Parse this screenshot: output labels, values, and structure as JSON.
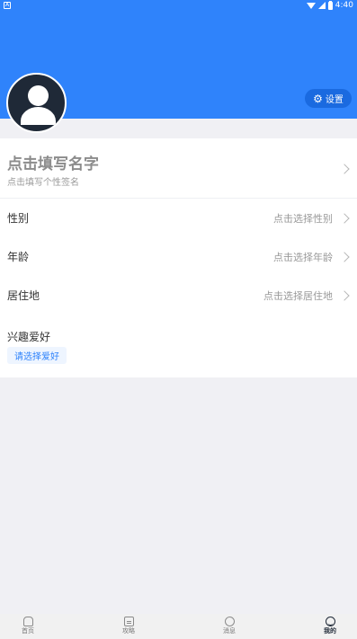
{
  "status_bar": {
    "time": "4:40",
    "left_icon": "A"
  },
  "settings_button": {
    "label": "设置",
    "icon": "gear-icon"
  },
  "profile": {
    "name_placeholder": "点击填写名字",
    "signature_placeholder": "点击填写个性签名"
  },
  "fields": [
    {
      "label": "性别",
      "value": "点击选择性别"
    },
    {
      "label": "年龄",
      "value": "点击选择年龄"
    },
    {
      "label": "居住地",
      "value": "点击选择居住地"
    }
  ],
  "hobbies": {
    "title": "兴趣爱好",
    "select_label": "请选择爱好"
  },
  "tabs": [
    {
      "label": "首页",
      "icon": "home-icon"
    },
    {
      "label": "攻略",
      "icon": "guide-icon"
    },
    {
      "label": "消息",
      "icon": "message-icon"
    },
    {
      "label": "我的",
      "icon": "profile-icon",
      "active": true
    }
  ],
  "colors": {
    "primary": "#2f83fb",
    "avatar_bg": "#1f2937",
    "background": "#f0f0f4"
  }
}
